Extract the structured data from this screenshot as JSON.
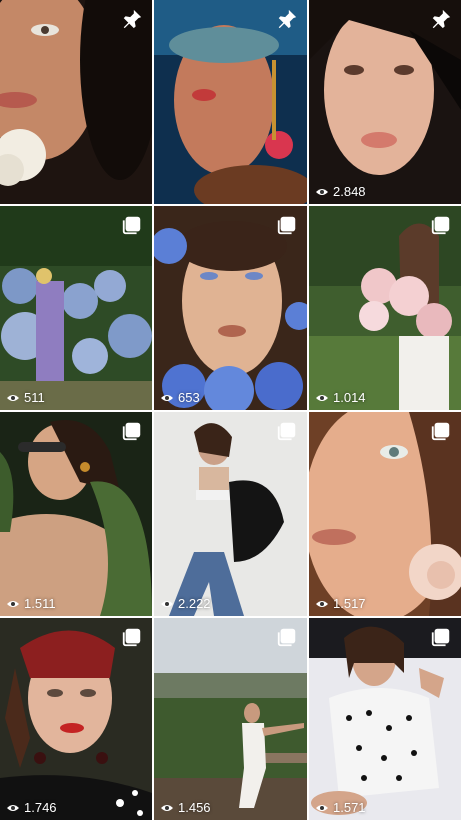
{
  "tiles": [
    {
      "name": "tile-1",
      "badge": "pin-icon",
      "views": ""
    },
    {
      "name": "tile-2",
      "badge": "pin-icon",
      "views": ""
    },
    {
      "name": "tile-3",
      "badge": "pin-icon",
      "views": "2.848"
    },
    {
      "name": "tile-4",
      "badge": "carousel-icon",
      "views": "511"
    },
    {
      "name": "tile-5",
      "badge": "carousel-icon",
      "views": "653"
    },
    {
      "name": "tile-6",
      "badge": "carousel-icon",
      "views": "1.014"
    },
    {
      "name": "tile-7",
      "badge": "carousel-icon",
      "views": "1.511"
    },
    {
      "name": "tile-8",
      "badge": "carousel-icon",
      "views": "2.222"
    },
    {
      "name": "tile-9",
      "badge": "carousel-icon",
      "views": "1.517"
    },
    {
      "name": "tile-10",
      "badge": "carousel-icon",
      "views": "1.746"
    },
    {
      "name": "tile-11",
      "badge": "carousel-icon",
      "views": "1.456"
    },
    {
      "name": "tile-12",
      "badge": "carousel-icon",
      "views": "1.571"
    }
  ]
}
